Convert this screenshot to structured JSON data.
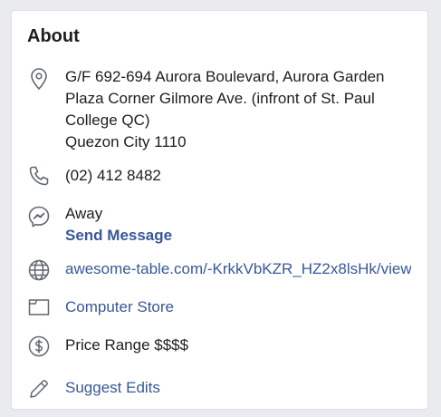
{
  "about": {
    "title": "About",
    "address": {
      "line1": "G/F 692-694 Aurora Boulevard, Aurora Garden",
      "line2": "Plaza Corner Gilmore Ave. (infront of St. Paul",
      "line3": "College QC)",
      "line4": "Quezon City 1110"
    },
    "phone": "(02) 412 8482",
    "messenger": {
      "status": "Away",
      "action": "Send Message"
    },
    "website": "awesome-table.com/-KrkkVbKZR_HZ2x8lsHk/view",
    "category": "Computer Store",
    "price_range": "Price Range $$$$",
    "suggest_edits": "Suggest Edits"
  },
  "colors": {
    "background": "#e9ebee",
    "card": "#ffffff",
    "text": "#1c1e21",
    "link": "#385898",
    "icon": "#606770"
  },
  "icons": [
    "location-pin-icon",
    "phone-icon",
    "messenger-icon",
    "globe-icon",
    "folder-icon",
    "dollar-icon",
    "pencil-icon"
  ]
}
